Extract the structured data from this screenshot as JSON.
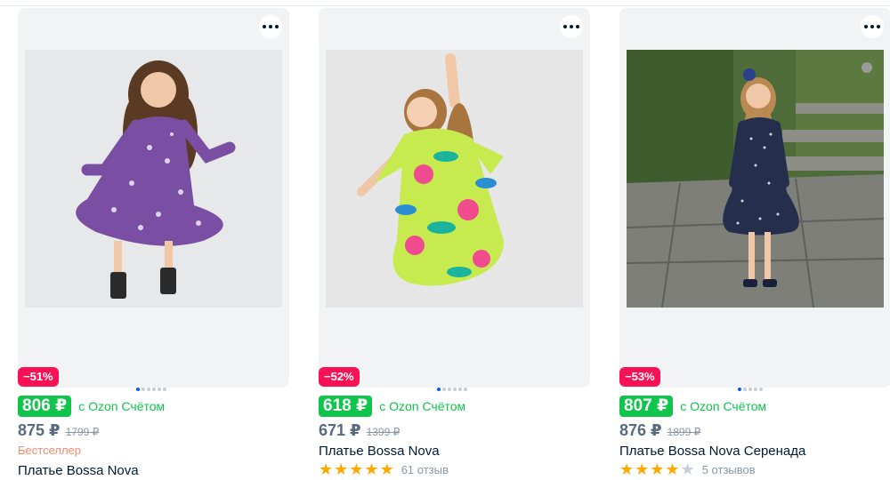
{
  "products": [
    {
      "discount": "−51%",
      "ozon_price": "806 ₽",
      "ozon_label": "с Ozon Счётом",
      "price": "875 ₽",
      "old_price": "1799 ₽",
      "badge": "Бестселлер",
      "title": "Платье Bossa Nova",
      "image_icon": "purple-dress-photo",
      "colors": {
        "dress": "#7a4fa3"
      }
    },
    {
      "discount": "−52%",
      "ozon_price": "618 ₽",
      "ozon_label": "с Ozon Счётом",
      "price": "671 ₽",
      "old_price": "1399 ₽",
      "title": "Платье Bossa Nova",
      "rating": 5,
      "reviews": "61 отзыв",
      "image_icon": "floral-dress-photo",
      "colors": {
        "dress": "#c7ea4f"
      }
    },
    {
      "discount": "−53%",
      "ozon_price": "807 ₽",
      "ozon_label": "с Ozon Счётом",
      "price": "876 ₽",
      "old_price": "1899 ₽",
      "title": "Платье Bossa Nova Серенада",
      "rating": 4,
      "reviews": "5 отзывов",
      "image_icon": "navy-dress-photo",
      "colors": {
        "dress": "#262e4d"
      }
    }
  ],
  "colors": {
    "discount": "#f91155",
    "ozon": "#10c44c",
    "bestseller": "#f58a6b",
    "star": "#ffa800"
  }
}
